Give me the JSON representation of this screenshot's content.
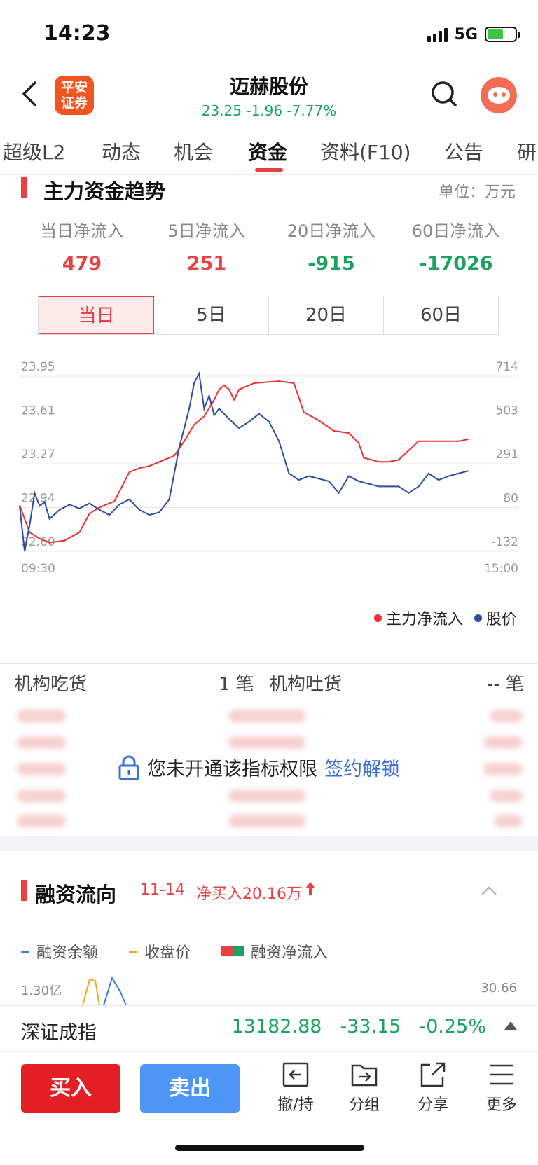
{
  "status": {
    "time": "14:23",
    "network": "5G"
  },
  "nav": {
    "logo_text": "平安证券",
    "stock_name": "迈赫股份",
    "quote": "23.25 -1.96 -7.77%"
  },
  "tabs": [
    "超级L2",
    "动态",
    "机会",
    "资金",
    "资料(F10)",
    "公告",
    "研"
  ],
  "active_tab": "资金",
  "main_flow": {
    "title": "主力资金趋势",
    "unit": "单位：万元",
    "stats": [
      {
        "label": "当日净流入",
        "value": "479",
        "color": "red"
      },
      {
        "label": "5日净流入",
        "value": "251",
        "color": "red"
      },
      {
        "label": "20日净流入",
        "value": "-915",
        "color": "green"
      },
      {
        "label": "60日净流入",
        "value": "-17026",
        "color": "green"
      }
    ],
    "periods": [
      "当日",
      "5日",
      "20日",
      "60日"
    ],
    "active_period": "当日"
  },
  "chart_data": {
    "type": "line",
    "title": "",
    "x_labels": [
      "09:30",
      "15:00"
    ],
    "left_axis": {
      "ticks": [
        "23.95",
        "23.61",
        "23.27",
        "22.94",
        "22.60"
      ],
      "range": [
        22.6,
        23.95
      ]
    },
    "right_axis": {
      "ticks": [
        "714",
        "503",
        "291",
        "80",
        "-132"
      ],
      "range": [
        -132,
        714
      ]
    },
    "grid": true,
    "legend_position": "bottom-right",
    "series": [
      {
        "name": "主力净流入",
        "color": "#ec2f2f",
        "axis": "right",
        "x": [
          0,
          0.02,
          0.04,
          0.06,
          0.09,
          0.12,
          0.14,
          0.16,
          0.19,
          0.22,
          0.24,
          0.26,
          0.28,
          0.31,
          0.33,
          0.35,
          0.37,
          0.38,
          0.39,
          0.4,
          0.41,
          0.42,
          0.43,
          0.44,
          0.47,
          0.52,
          0.55,
          0.57,
          0.6,
          0.63,
          0.66,
          0.68,
          0.69,
          0.72,
          0.74,
          0.76,
          0.8,
          0.82,
          0.85,
          0.88,
          0.9
        ],
        "values": [
          90,
          -40,
          -70,
          -90,
          -80,
          -40,
          50,
          80,
          110,
          250,
          270,
          280,
          300,
          330,
          400,
          480,
          520,
          560,
          600,
          650,
          670,
          650,
          600,
          650,
          680,
          690,
          680,
          540,
          500,
          450,
          440,
          390,
          320,
          300,
          300,
          310,
          400,
          400,
          400,
          400,
          410
        ]
      },
      {
        "name": "股价",
        "color": "#2c4d9e",
        "axis": "left",
        "x": [
          0,
          0.01,
          0.02,
          0.03,
          0.04,
          0.05,
          0.06,
          0.08,
          0.1,
          0.12,
          0.14,
          0.16,
          0.18,
          0.2,
          0.22,
          0.24,
          0.26,
          0.28,
          0.3,
          0.32,
          0.33,
          0.34,
          0.35,
          0.36,
          0.37,
          0.38,
          0.39,
          0.4,
          0.42,
          0.44,
          0.46,
          0.48,
          0.5,
          0.52,
          0.54,
          0.56,
          0.58,
          0.6,
          0.62,
          0.64,
          0.66,
          0.68,
          0.7,
          0.72,
          0.74,
          0.76,
          0.78,
          0.8,
          0.82,
          0.84,
          0.86,
          0.88,
          0.9
        ],
        "values": [
          22.95,
          22.6,
          22.8,
          23.05,
          22.95,
          22.98,
          22.85,
          22.92,
          22.96,
          22.93,
          22.97,
          22.92,
          22.88,
          22.96,
          23.0,
          22.92,
          22.88,
          22.9,
          23.0,
          23.4,
          23.55,
          23.7,
          23.9,
          23.97,
          23.7,
          23.8,
          23.65,
          23.7,
          23.62,
          23.55,
          23.6,
          23.66,
          23.6,
          23.45,
          23.2,
          23.15,
          23.18,
          23.16,
          23.14,
          23.05,
          23.18,
          23.14,
          23.12,
          23.1,
          23.1,
          23.1,
          23.05,
          23.1,
          23.2,
          23.15,
          23.18,
          23.2,
          23.22
        ]
      }
    ]
  },
  "institution": {
    "buy_label": "机构吃货",
    "buy_count": "1 笔",
    "sell_label": "机构吐货",
    "sell_count": "-- 笔",
    "locked_text": "您未开通该指标权限",
    "unlock_link": "签约解锁"
  },
  "margin": {
    "title": "融资流向",
    "date": "11-14",
    "net_text": "净买入20.16万",
    "legend": [
      "融资余额",
      "收盘价",
      "融资净流入"
    ],
    "left_tick": "1.30亿",
    "right_tick": "30.66"
  },
  "index": {
    "name": "深证成指",
    "value": "13182.88",
    "change": "-33.15",
    "pct": "-0.25%"
  },
  "bottom": {
    "buy": "买入",
    "sell": "卖出",
    "tools": [
      "撤/持",
      "分组",
      "分享",
      "更多"
    ]
  },
  "colors": {
    "up": "#e84141",
    "down": "#1aa260",
    "buy_button": "#e51e25",
    "sell_button": "#4e96f5",
    "link": "#3a6fd8"
  }
}
